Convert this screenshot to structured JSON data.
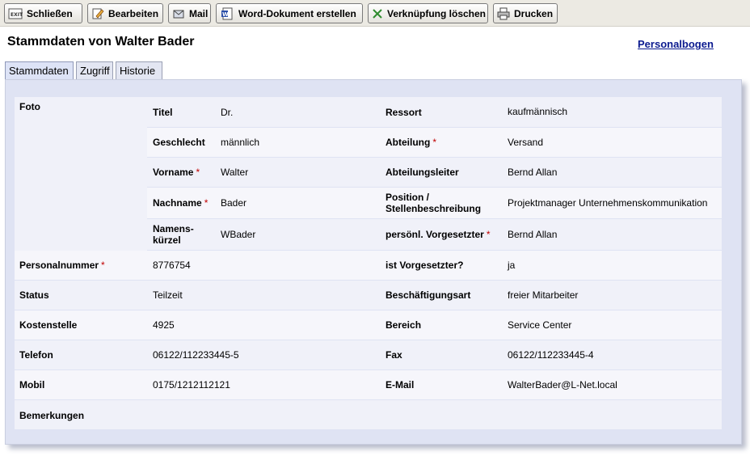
{
  "toolbar": {
    "close": "Schließen",
    "edit": "Bearbeiten",
    "mail": "Mail",
    "word": "Word-Dokument erstellen",
    "unlink": "Verknüpfung löschen",
    "print": "Drucken"
  },
  "page": {
    "title": "Stammdaten von Walter Bader",
    "personalbogen_link": "Personalbogen"
  },
  "tabs": [
    "Stammdaten",
    "Zugriff",
    "Historie"
  ],
  "form": {
    "foto_label": "Foto",
    "titel_label": "Titel",
    "titel_value": "Dr.",
    "ressort_label": "Ressort",
    "ressort_value": "kaufmännisch",
    "geschlecht_label": "Geschlecht",
    "geschlecht_value": "männlich",
    "abteilung_label": "Abteilung",
    "abteilung_value": "Versand",
    "vorname_label": "Vorname",
    "vorname_value": "Walter",
    "abteilungsleiter_label": "Abteilungsleiter",
    "abteilungsleiter_value": "Bernd Allan",
    "nachname_label": "Nachname",
    "nachname_value": "Bader",
    "position_label_1": "Position /",
    "position_label_2": "Stellenbeschreibung",
    "position_value": "Projektmanager Unternehmenskommunikation",
    "kuerzel_label_1": "Namens-",
    "kuerzel_label_2": "kürzel",
    "kuerzel_value": "WBader",
    "vorgesetzter_label": "persönl. Vorgesetzter",
    "vorgesetzter_value": "Bernd Allan",
    "personalnummer_label": "Personalnummer",
    "personalnummer_value": "8776754",
    "ist_vorgesetzter_label": "ist Vorgesetzter?",
    "ist_vorgesetzter_value": "ja",
    "status_label": "Status",
    "status_value": "Teilzeit",
    "beschaeftigungsart_label": "Beschäftigungsart",
    "beschaeftigungsart_value": "freier Mitarbeiter",
    "kostenstelle_label": "Kostenstelle",
    "kostenstelle_value": "4925",
    "bereich_label": "Bereich",
    "bereich_value": "Service Center",
    "telefon_label": "Telefon",
    "telefon_value": "06122/112233445-5",
    "fax_label": "Fax",
    "fax_value": "06122/112233445-4",
    "mobil_label": "Mobil",
    "mobil_value": "0175/1212112121",
    "email_label": "E-Mail",
    "email_value": "WalterBader@L-Net.local",
    "bemerkungen_label": "Bemerkungen",
    "required_marker": "*"
  }
}
